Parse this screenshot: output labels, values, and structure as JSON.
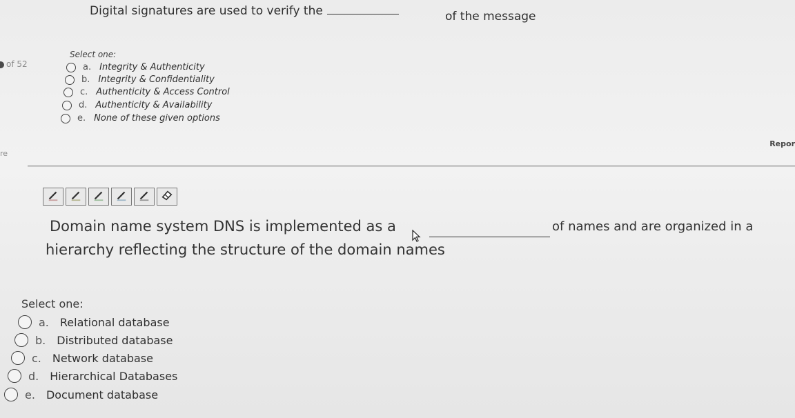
{
  "q1": {
    "text_before": "Digital signatures are used to verify the",
    "text_after": "of the message",
    "select_label": "Select one:",
    "options": [
      {
        "letter": "a.",
        "text": "Integrity & Authenticity"
      },
      {
        "letter": "b.",
        "text": "Integrity & Confidentiality"
      },
      {
        "letter": "c.",
        "text": "Authenticity & Access Control"
      },
      {
        "letter": "d.",
        "text": "Authenticity & Availability"
      },
      {
        "letter": "e.",
        "text": "None of these given options"
      }
    ]
  },
  "sidebar": {
    "question_count": "of 52",
    "partial_label": "re"
  },
  "report_label": "Repor",
  "toolbar": {
    "icons": [
      "pencil-icon",
      "pencil-icon",
      "pencil-icon",
      "pencil-icon",
      "pencil-icon",
      "eraser-icon"
    ]
  },
  "q2": {
    "text_line1": "Domain name system DNS is implemented as a",
    "text_after_blank": "of names and are organized in a",
    "text_line2": "hierarchy reflecting the structure of the domain names",
    "select_label": "Select one:",
    "options": [
      {
        "letter": "a.",
        "text": "Relational database"
      },
      {
        "letter": "b.",
        "text": "Distributed database"
      },
      {
        "letter": "c.",
        "text": "Network database"
      },
      {
        "letter": "d.",
        "text": "Hierarchical Databases"
      },
      {
        "letter": "e.",
        "text": "Document database"
      }
    ]
  }
}
